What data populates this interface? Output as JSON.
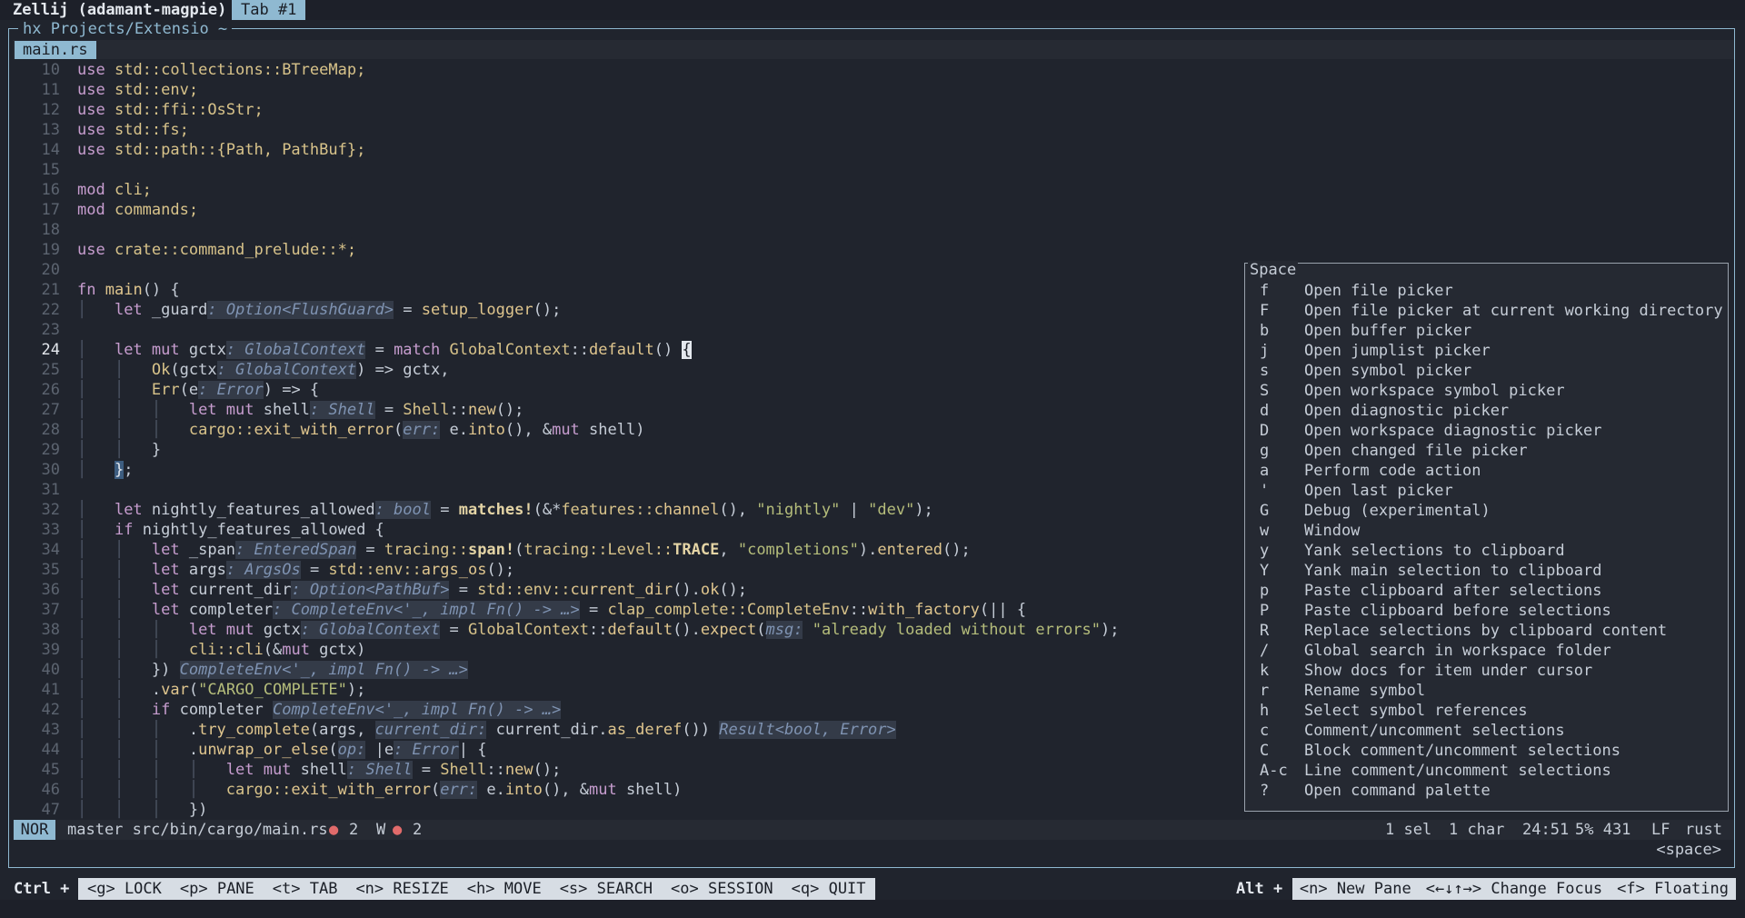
{
  "zellij": {
    "session_label": "Zellij (adamant-magpie)",
    "tab_label": "Tab #1",
    "pane_title": "hx Projects/Extensio ~"
  },
  "editor": {
    "buffer_tab": "main.rs",
    "line_numbers": [
      "10",
      "11",
      "12",
      "13",
      "14",
      "15",
      "16",
      "17",
      "18",
      "19",
      "20",
      "21",
      "22",
      "23",
      "24",
      "25",
      "26",
      "27",
      "28",
      "29",
      "30",
      "31",
      "32",
      "33",
      "34",
      "35",
      "36",
      "37",
      "38",
      "39",
      "40",
      "41",
      "42",
      "43",
      "44",
      "45",
      "46",
      "47"
    ],
    "current_line": "24",
    "code": {
      "l10": [
        "use",
        "std::collections::BTreeMap;"
      ],
      "l11": [
        "use",
        "std::env;"
      ],
      "l12": [
        "use",
        "std::ffi::OsStr;"
      ],
      "l13": [
        "use",
        "std::fs;"
      ],
      "l14": [
        "use",
        "std::path::{Path, PathBuf};"
      ],
      "l16": [
        "mod",
        "cli;"
      ],
      "l17": [
        "mod",
        "commands;"
      ],
      "l19": [
        "use",
        "crate::command_prelude::*;"
      ],
      "l21": [
        "fn",
        "main",
        "() {"
      ],
      "l22": [
        "let",
        "_guard",
        ": Option<FlushGuard>",
        " = ",
        "setup_logger",
        "();"
      ],
      "l24": [
        "let mut",
        "gctx",
        ": GlobalContext",
        " = ",
        "match",
        "GlobalContext",
        "::",
        "default",
        "() ",
        "{"
      ],
      "l25": [
        "Ok",
        "(gctx",
        ": GlobalContext",
        ") => gctx,"
      ],
      "l26": [
        "Err",
        "(e",
        ": Error",
        ") => {"
      ],
      "l27": [
        "let mut",
        "shell",
        ": Shell",
        " = ",
        "Shell",
        "::",
        "new",
        "();"
      ],
      "l28": [
        "cargo::",
        "exit_with_error",
        "(",
        "err:",
        " e.",
        "into",
        "(), &",
        "mut",
        " shell)"
      ],
      "l29": [
        "}"
      ],
      "l30": [
        "}",
        ";"
      ],
      "l32": [
        "let",
        "nightly_features_allowed",
        ": bool",
        " = ",
        "matches!",
        "(&*",
        "features::",
        "channel",
        "(), ",
        "\"nightly\"",
        " | ",
        "\"dev\"",
        ");"
      ],
      "l33": [
        "if",
        "nightly_features_allowed {"
      ],
      "l34": [
        "let",
        "_span",
        ": EnteredSpan",
        " = ",
        "tracing::",
        "span!",
        "(",
        "tracing::",
        "Level::",
        "TRACE",
        ", ",
        "\"completions\"",
        ").",
        "entered",
        "();"
      ],
      "l35": [
        "let",
        "args",
        ": ArgsOs",
        " = ",
        "std::env::",
        "args_os",
        "();"
      ],
      "l36": [
        "let",
        "current_dir",
        ": Option<PathBuf>",
        " = ",
        "std::env::",
        "current_dir",
        "().",
        "ok",
        "();"
      ],
      "l37": [
        "let",
        "completer",
        ": CompleteEnv<'_, impl Fn() -> …>",
        " = ",
        "clap_complete::",
        "CompleteEnv",
        "::",
        "with_factory",
        "(|| {"
      ],
      "l38": [
        "let mut",
        "gctx",
        ": GlobalContext",
        " = ",
        "GlobalContext",
        "::",
        "default",
        "().",
        "expect",
        "(",
        "msg:",
        " ",
        "\"already loaded without errors\"",
        ");"
      ],
      "l39": [
        "cli::",
        "cli",
        "(&",
        "mut",
        " gctx)"
      ],
      "l40": [
        "})",
        " ",
        "CompleteEnv<'_, impl Fn() -> …>"
      ],
      "l41": [
        ".",
        "var",
        "(",
        "\"CARGO_COMPLETE\"",
        ");"
      ],
      "l42": [
        "if",
        "completer",
        " ",
        "CompleteEnv<'_, impl Fn() -> …>"
      ],
      "l43": [
        ".",
        "try_complete",
        "(args, ",
        "current_dir:",
        " current_dir.",
        "as_deref",
        "()) ",
        "Result<bool, Error>"
      ],
      "l44": [
        ".",
        "unwrap_or_else",
        "(",
        "op:",
        " |e",
        ": Error",
        "| {"
      ],
      "l45": [
        "let mut",
        "shell",
        ": Shell",
        " = ",
        "Shell",
        "::",
        "new",
        "();"
      ],
      "l46": [
        "cargo::",
        "exit_with_error",
        "(",
        "err:",
        " e.",
        "into",
        "(), &",
        "mut",
        " shell)"
      ],
      "l47": [
        "})"
      ]
    }
  },
  "popup": {
    "title": "Space",
    "items": [
      {
        "key": "f",
        "desc": "Open file picker"
      },
      {
        "key": "F",
        "desc": "Open file picker at current working directory"
      },
      {
        "key": "b",
        "desc": "Open buffer picker"
      },
      {
        "key": "j",
        "desc": "Open jumplist picker"
      },
      {
        "key": "s",
        "desc": "Open symbol picker"
      },
      {
        "key": "S",
        "desc": "Open workspace symbol picker"
      },
      {
        "key": "d",
        "desc": "Open diagnostic picker"
      },
      {
        "key": "D",
        "desc": "Open workspace diagnostic picker"
      },
      {
        "key": "g",
        "desc": "Open changed file picker"
      },
      {
        "key": "a",
        "desc": "Perform code action"
      },
      {
        "key": "'",
        "desc": "Open last picker"
      },
      {
        "key": "G",
        "desc": "Debug (experimental)"
      },
      {
        "key": "w",
        "desc": "Window"
      },
      {
        "key": "y",
        "desc": "Yank selections to clipboard"
      },
      {
        "key": "Y",
        "desc": "Yank main selection to clipboard"
      },
      {
        "key": "p",
        "desc": "Paste clipboard after selections"
      },
      {
        "key": "P",
        "desc": "Paste clipboard before selections"
      },
      {
        "key": "R",
        "desc": "Replace selections by clipboard content"
      },
      {
        "key": "/",
        "desc": "Global search in workspace folder"
      },
      {
        "key": "k",
        "desc": "Show docs for item under cursor"
      },
      {
        "key": "r",
        "desc": "Rename symbol"
      },
      {
        "key": "h",
        "desc": "Select symbol references"
      },
      {
        "key": "c",
        "desc": "Comment/uncomment selections"
      },
      {
        "key": "C",
        "desc": "Block comment/uncomment selections"
      },
      {
        "key": "A-c",
        "desc": "Line comment/uncomment selections"
      },
      {
        "key": "?",
        "desc": "Open command palette"
      }
    ]
  },
  "statusline": {
    "mode": "NOR",
    "branch_file": "master src/bin/cargo/main.rs",
    "dot": "●",
    "errors": "2",
    "warn_label": "W",
    "warnings": "2",
    "selections": "1 sel",
    "chars": "1 char",
    "position": "24:51",
    "percent": "5% 431",
    "line_ending": "LF",
    "language": "rust",
    "pending_keys": "<space>"
  },
  "bottombar": {
    "ctrl_label": "Ctrl +",
    "keys_left": [
      "<g> LOCK",
      "<p> PANE",
      "<t> TAB",
      "<n> RESIZE",
      "<h> MOVE",
      "<s> SEARCH",
      "<o> SESSION",
      "<q> QUIT"
    ],
    "alt_label": "Alt +",
    "keys_right": [
      "<n> New Pane",
      "<←↓↑→> Change Focus",
      "<f> Floating"
    ]
  },
  "colors": {
    "accent": "#8fb9d1",
    "background": "#20242d",
    "diagnostic_dot": "#e16b6b"
  }
}
